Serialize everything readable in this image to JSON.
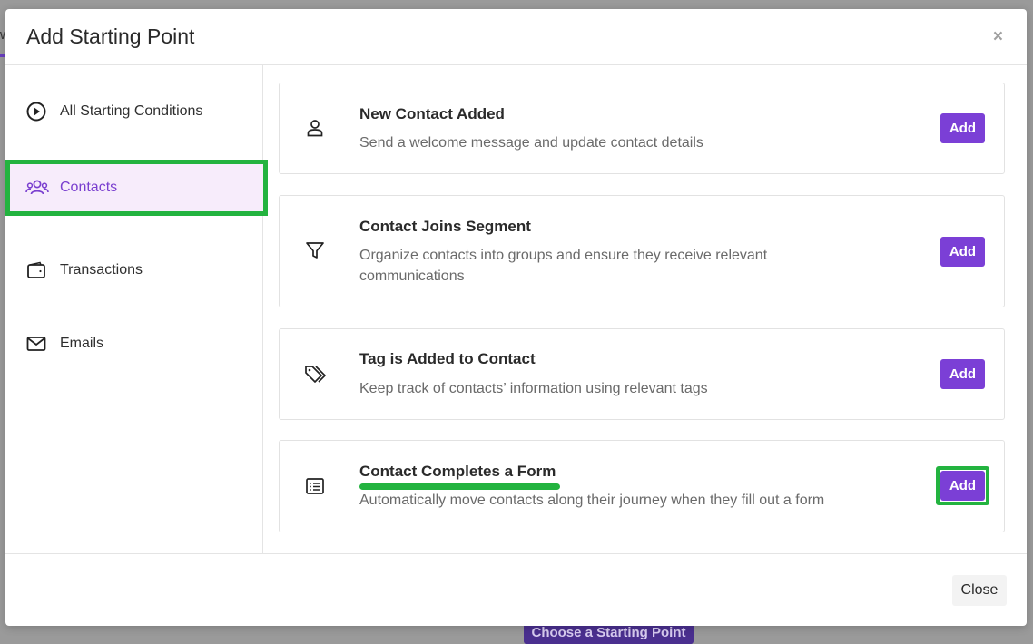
{
  "backdrop": {
    "tab_letter": "w",
    "button_label": "Choose a Starting Point"
  },
  "modal": {
    "title": "Add Starting Point",
    "close_icon": "×"
  },
  "sidebar": {
    "items": [
      {
        "label": "All Starting Conditions",
        "icon": "play-circle-icon",
        "active": false
      },
      {
        "label": "Contacts",
        "icon": "users-icon",
        "active": true
      },
      {
        "label": "Transactions",
        "icon": "wallet-icon",
        "active": false
      },
      {
        "label": "Emails",
        "icon": "envelope-icon",
        "active": false
      }
    ]
  },
  "cards": [
    {
      "title": "New Contact Added",
      "description": "Send a welcome message and update contact details",
      "icon": "user-icon",
      "button": "Add"
    },
    {
      "title": "Contact Joins Segment",
      "description": "Organize contacts into groups and ensure they receive relevant communications",
      "icon": "filter-icon",
      "button": "Add"
    },
    {
      "title": "Tag is Added to Contact",
      "description": "Keep track of contacts’ information using relevant tags",
      "icon": "tags-icon",
      "button": "Add"
    },
    {
      "title": "Contact Completes a Form",
      "description": "Automatically move contacts along their journey when they fill out a form",
      "icon": "form-list-icon",
      "button": "Add"
    }
  ],
  "footer": {
    "close_label": "Close"
  },
  "colors": {
    "accent": "#7b3fd6",
    "highlight": "#23b33f",
    "active_bg": "#f7ecfb"
  }
}
